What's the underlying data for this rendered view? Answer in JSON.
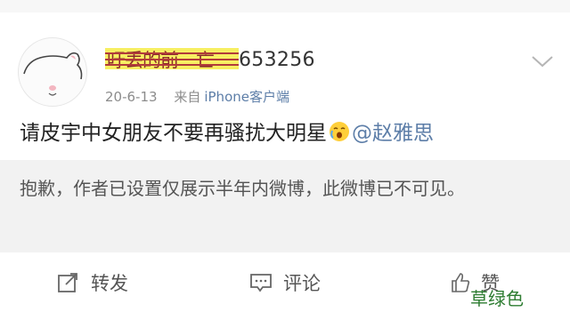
{
  "post": {
    "username_masked": "吁丢的前一亡",
    "username_visible": "653256",
    "date": "20-6-13",
    "source_prefix": "来自",
    "source_client": "iPhone客户端",
    "text": "请皮宇中女朋友不要再骚扰大明星",
    "emoji": "crying-face-icon",
    "mention": "@赵雅思"
  },
  "notice": {
    "text": "抱歉，作者已设置仅展示半年内微博，此微博已不可见。"
  },
  "actions": {
    "repost_label": "转发",
    "comment_label": "评论",
    "like_label": "赞"
  },
  "watermark": "草绿色",
  "colors": {
    "link": "#5d7ea8",
    "meta": "#8c8c8c",
    "highlight": "#f7ef62",
    "notice_bg": "#f2f2f2",
    "watermark": "#2e7d32"
  }
}
